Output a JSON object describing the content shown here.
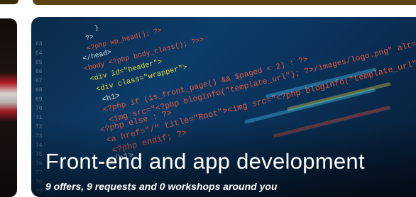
{
  "card": {
    "title": "Front-end and app development",
    "subtitle": "9 offers, 9 requests and 0 workshops around you"
  },
  "image": {
    "code_lines": [
      "}",
      "?>",
      "<?php wp_head(); ?>",
      "</head>",
      "<body <?php body_class(); ?>>",
      "<div id=\"header\">",
      "<div class=\"wrapper\">",
      "<h1>",
      "<?php if (is_front_page() && $paged < 2) : ?>",
      "<img src=\"<?php bloginfo(\"template_url\"); ?>/images/logo.png\" alt=\"",
      "<?php else : ?>",
      "<a href=\"/\" title=\"Root\"><img src=\"<?php bloginfo(\"template_url\"); ?>",
      "<?php endif; ?>",
      "</h1>"
    ],
    "line_numbers": [
      "63",
      "64",
      "65",
      "66",
      "67",
      "68",
      "69",
      "70",
      "71",
      "72",
      "73",
      "74",
      "75",
      "76",
      "77",
      "78",
      "79"
    ]
  },
  "colors": {
    "card_bg": "#0c3c69",
    "code_default": "#e8ecf2",
    "code_keyword": "#ff5a3c",
    "code_string": "#f4e13a",
    "code_attr": "#4fd7ff"
  }
}
